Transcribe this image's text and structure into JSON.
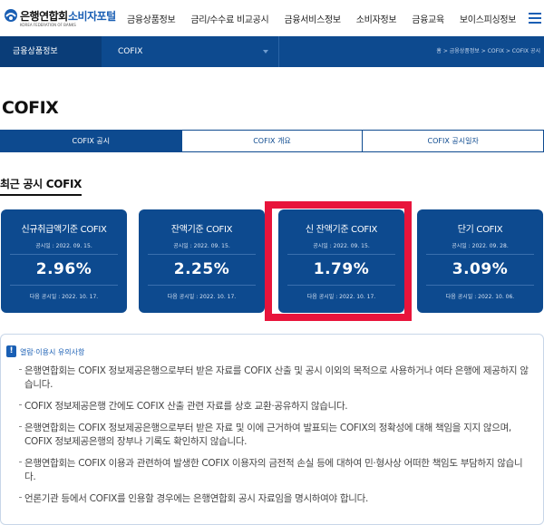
{
  "header": {
    "logo_name": "은행연합회",
    "logo_sub": "KOREA FEDERATION OF BANKS",
    "logo_portal": "소비자포털",
    "nav": [
      "금융상품정보",
      "금리/수수료 비교공시",
      "금융서비스정보",
      "소비자정보",
      "금융교육",
      "보이스피싱정보"
    ]
  },
  "subbar": {
    "category": "금융상품정보",
    "selected": "COFIX",
    "breadcrumb": "홈 > 금융상품정보 > COFIX > COFIX 공시"
  },
  "page_title": "COFIX",
  "tabs": [
    {
      "label": "COFIX 공시",
      "active": true
    },
    {
      "label": "COFIX 개요",
      "active": false
    },
    {
      "label": "COFIX 공시일자",
      "active": false
    }
  ],
  "section_title": "최근 공시 COFIX",
  "cards": [
    {
      "title": "신규취급액기준 COFIX",
      "date": "공시일 : 2022. 09. 15.",
      "value": "2.96%",
      "next": "다음 공시일 : 2022. 10. 17."
    },
    {
      "title": "잔액기준 COFIX",
      "date": "공시일 : 2022. 09. 15.",
      "value": "2.25%",
      "next": "다음 공시일 : 2022. 10. 17."
    },
    {
      "title": "신 잔액기준 COFIX",
      "date": "공시일 : 2022. 09. 15.",
      "value": "1.79%",
      "next": "다음 공시일 : 2022. 10. 17."
    },
    {
      "title": "단기 COFIX",
      "date": "공시일 : 2022. 09. 28.",
      "value": "3.09%",
      "next": "다음 공시일 : 2022. 10. 06."
    }
  ],
  "notice": {
    "badge": "!",
    "title": "열람·이용시 유의사항",
    "items": [
      "은행연합회는 COFIX 정보제공은행으로부터 받은 자료를 COFIX 산출 및 공시 이외의 목적으로 사용하거나 여타 은행에 제공하지 않습니다.",
      "COFIX 정보제공은행 간에도 COFIX 산출 관련 자료를 상호 교환·공유하지 않습니다.",
      "은행연합회는 COFIX 정보제공은행으로부터 받은 자료 및 이에 근거하여 발표되는 COFIX의 정확성에 대해 책임을 지지 않으며, COFIX 정보제공은행의 장부나 기록도 확인하지 않습니다.",
      "은행연합회는 COFIX 이용과 관련하여 발생한 COFIX 이용자의 금전적 손실 등에 대하여 민·형사상 어떠한 책임도 부담하지 않습니다.",
      "언론기관 등에서 COFIX를 인용할 경우에는 은행연합회 공시 자료임을 명시하여야 합니다."
    ]
  }
}
